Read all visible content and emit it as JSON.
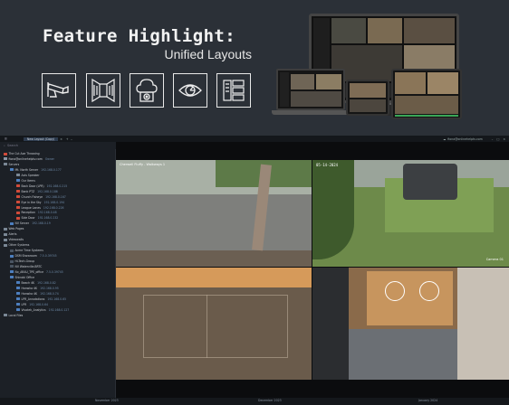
{
  "banner": {
    "title": "Feature Highlight:",
    "subtitle": "Unified Layouts",
    "feature_icons": [
      "cctv-camera-icon",
      "perspective-walls-icon",
      "video-storage-icon",
      "eye-analytics-icon",
      "multi-panel-layout-icon"
    ]
  },
  "app": {
    "tab_label": "New Layout (Copy)",
    "search_placeholder": "Search",
    "user": "fiona@onlinehelptv.com",
    "tree": [
      {
        "label": "The Cut Axe Throwing",
        "ip": "",
        "indent": 0,
        "color": "#d14b3a"
      },
      {
        "label": "fiona@onlinehelptv.com",
        "ip": "Owner",
        "indent": 0,
        "color": "#8b97a6"
      },
      {
        "label": "Servers",
        "ip": "",
        "indent": 0,
        "color": "#7b8896"
      },
      {
        "label": "Mt. North Server",
        "ip": "192.168.0.177",
        "indent": 1,
        "color": "#4d7fbf"
      },
      {
        "label": "Axis Speaker",
        "ip": "",
        "indent": 2,
        "color": "#7b8896"
      },
      {
        "label": "Our Items",
        "ip": "",
        "indent": 2,
        "color": "#4d7fbf"
      },
      {
        "label": "Back Door (LPR)",
        "ip": "192.168.0.215",
        "indent": 2,
        "color": "#d14b3a"
      },
      {
        "label": "Bank PTZ",
        "ip": "192.168.0.186",
        "indent": 2,
        "color": "#d14b3a"
      },
      {
        "label": "Church Fisheye",
        "ip": "192.168.0.167",
        "indent": 2,
        "color": "#d14b3a"
      },
      {
        "label": "Eye in the Sky",
        "ip": "192.168.0.194",
        "indent": 2,
        "color": "#d14b3a"
      },
      {
        "label": "League Lanes",
        "ip": "192.168.0.226",
        "indent": 2,
        "color": "#d14b3a"
      },
      {
        "label": "Reception",
        "ip": "192.168.0.48",
        "indent": 2,
        "color": "#d14b3a"
      },
      {
        "label": "Side Door",
        "ip": "192.168.0.232",
        "indent": 2,
        "color": "#d14b3a"
      },
      {
        "label": "NV Server",
        "ip": "192.168.0.19",
        "indent": 1,
        "color": "#4d7fbf"
      },
      {
        "label": "Web Pages",
        "ip": "",
        "indent": 0,
        "color": "#7b8896"
      },
      {
        "label": "Alerts",
        "ip": "",
        "indent": 0,
        "color": "#7b8896"
      },
      {
        "label": "Videowalls",
        "ip": "",
        "indent": 0,
        "color": "#7b8896"
      },
      {
        "label": "Other Systems",
        "ip": "",
        "indent": 0,
        "color": "#7b8896"
      },
      {
        "label": "Acme Time Systems",
        "ip": "",
        "indent": 1,
        "color": "#4a5563"
      },
      {
        "label": "DSM Showroom",
        "ip": "7.5.0.39745",
        "indent": 1,
        "color": "#4d7fbf"
      },
      {
        "label": "Hi-Tech-Group",
        "ip": "",
        "indent": 1,
        "color": "#4a5563"
      },
      {
        "label": "NV Waterville-BRTC",
        "ip": "",
        "indent": 1,
        "color": "#4a5563"
      },
      {
        "label": "Nx_ARAU_TPE_office",
        "ip": "7.5.0.39745",
        "indent": 1,
        "color": "#4d7fbf"
      },
      {
        "label": "Shinobi Office",
        "ip": "",
        "indent": 1,
        "color": "#4d7fbf"
      },
      {
        "label": "Beach 4K",
        "ip": "192.168.0.82",
        "indent": 2,
        "color": "#4d7fbf"
      },
      {
        "label": "Hanwha 4K",
        "ip": "192.168.0.95",
        "indent": 2,
        "color": "#4d7fbf"
      },
      {
        "label": "Hanwha 4K",
        "ip": "192.168.0.74",
        "indent": 2,
        "color": "#4d7fbf"
      },
      {
        "label": "LPR_Annotations",
        "ip": "192.168.0.65",
        "indent": 2,
        "color": "#4d7fbf"
      },
      {
        "label": "LPR",
        "ip": "192.168.0.64",
        "indent": 2,
        "color": "#4d7fbf"
      },
      {
        "label": "Vivotek_Analytics",
        "ip": "192.168.0.127",
        "indent": 2,
        "color": "#4d7fbf"
      },
      {
        "label": "Local Files",
        "ip": "",
        "indent": 0,
        "color": "#7b8896"
      }
    ],
    "cameras": [
      {
        "label": "Cherwell Fluffy - Walkways 1",
        "stamp": ""
      },
      {
        "label": "",
        "stamp": "05-14-2024"
      },
      {
        "label": "",
        "stamp": "Camera 01"
      },
      {
        "label": "",
        "stamp": ""
      }
    ],
    "timeline": {
      "months": [
        "November 2023",
        "December 2023",
        "January 2024"
      ]
    }
  },
  "colors": {
    "accent": "#3e7fd6",
    "status_red": "#d14b3a",
    "banner_bg": "#2b3037",
    "app_bg": "#1a1d22"
  }
}
